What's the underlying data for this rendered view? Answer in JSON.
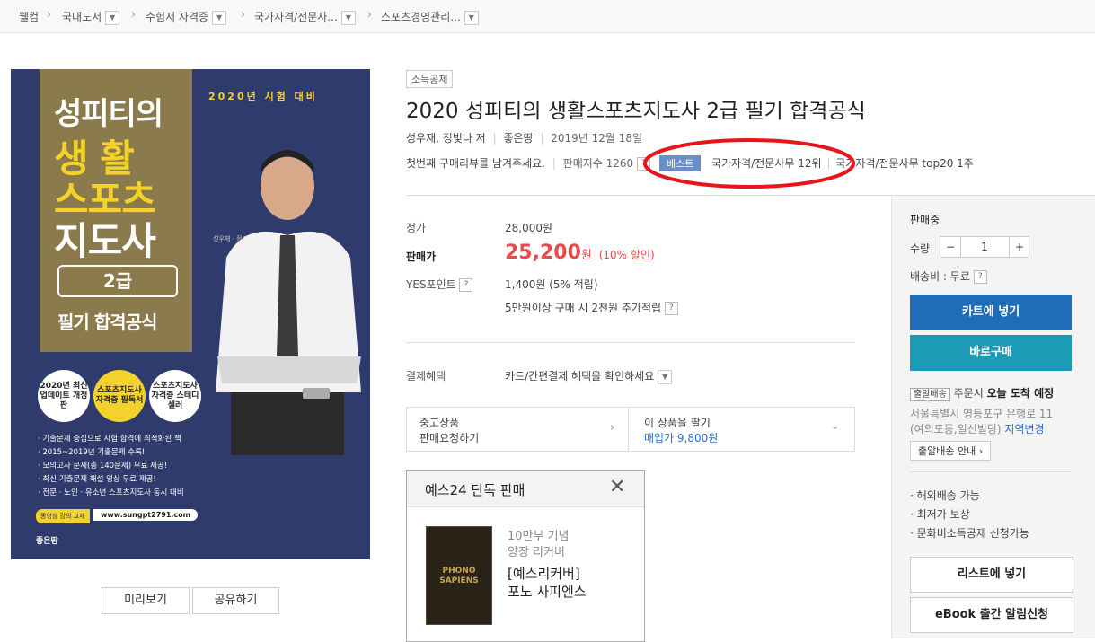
{
  "breadcrumb": [
    "웰컴",
    "국내도서",
    "수험서 자격증",
    "국가자격/전문사...",
    "스포츠경영관리..."
  ],
  "cover": {
    "exam_year": "2020년 시험 대비",
    "title_line1": "성피티의",
    "title_line2": "생 활",
    "title_line3": "스포츠",
    "title_line4": "지도사",
    "grade": "2급",
    "subtitle": "필기 합격공식",
    "author_small": "성우재 · 정빛나 지음",
    "badges": [
      "2020년 최신 업데이트 개정판",
      "스포츠지도사 자격증 필독서",
      "스포츠지도사 자격증 스테디셀러"
    ],
    "bullets": [
      "· 기출문제 중심으로 시험 합격에 최적화된 책",
      "· 2015~2019년 기출문제 수록!",
      "· 모의고사 문제(총 140문제) 무료 제공!",
      "· 최신 기출문제 해설 영상 무료 제공!",
      "· 전문 · 노인 · 유소년 스포츠지도사 동시 대비"
    ],
    "lecture_label": "동영상 강의 교재",
    "site": "www.sungpt2791.com",
    "publisher_logo": "좋은땅"
  },
  "cover_buttons": {
    "preview": "미리보기",
    "share": "공유하기"
  },
  "product": {
    "tag": "소득공제",
    "title": "2020 성피티의 생활스포츠지도사 2급 필기 합격공식",
    "authors": "성우재, 정빛나 저",
    "publisher": "좋은땅",
    "date": "2019년 12월 18일",
    "review_prompt": "첫번째 구매리뷰를 남겨주세요.",
    "sales_index": "판매지수 1260",
    "best_label": "베스트",
    "rank_text": "국가자격/전문사무 12위",
    "top20_text": "국가자격/전문사무 top20 1주"
  },
  "price": {
    "list_label": "정가",
    "list_value": "28,000원",
    "sale_label": "판매가",
    "sale_number": "25,200",
    "sale_unit": "원",
    "discount": "(10% 할인)",
    "point_label": "YES포인트",
    "point_value": "1,400원 (5% 적립)",
    "point_extra": "5만원이상 구매 시 2천원 추가적립",
    "payment_label": "결제혜택",
    "payment_value": "카드/간편결제 혜택을 확인하세요"
  },
  "used": {
    "left_line1": "중고상품",
    "left_line2": "판매요청하기",
    "right_line1": "이 상품을 팔기",
    "right_line2": "매입가 9,800원"
  },
  "exclusive": {
    "header": "예스24 단독 판매",
    "line1": "10만부 기념",
    "line2": "양장 리커버",
    "line3": "[예스리커버]",
    "line4": "포노 사피엔스",
    "thumb_title": "PHONO SAPIENS"
  },
  "side": {
    "status": "판매중",
    "qty_label": "수량",
    "qty_value": "1",
    "shipping": "배송비 : 무료",
    "cart": "카트에 넣기",
    "buy": "바로구매",
    "delivery_tag": "출알배송",
    "delivery_prefix": "주문시",
    "delivery_strong": "오늘 도착 예정",
    "address1": "서울특별시 영등포구 은행로 11",
    "address2": "(여의도동,일신빌딩)",
    "region_change": "지역변경",
    "delivery_info": "출알배송 안내",
    "bullets": [
      "· 해외배송 가능",
      "· 최저가 보상",
      "· 문화비소득공제 신청가능"
    ],
    "wishlist": "리스트에 넣기",
    "ebook": "eBook 출간 알림신청"
  },
  "colors": {
    "cart": "#1f6cb8",
    "buy": "#1b9bb5",
    "price": "#e74b4b",
    "cover_bg": "#2f3b6c",
    "highlight": "#e8151b"
  }
}
